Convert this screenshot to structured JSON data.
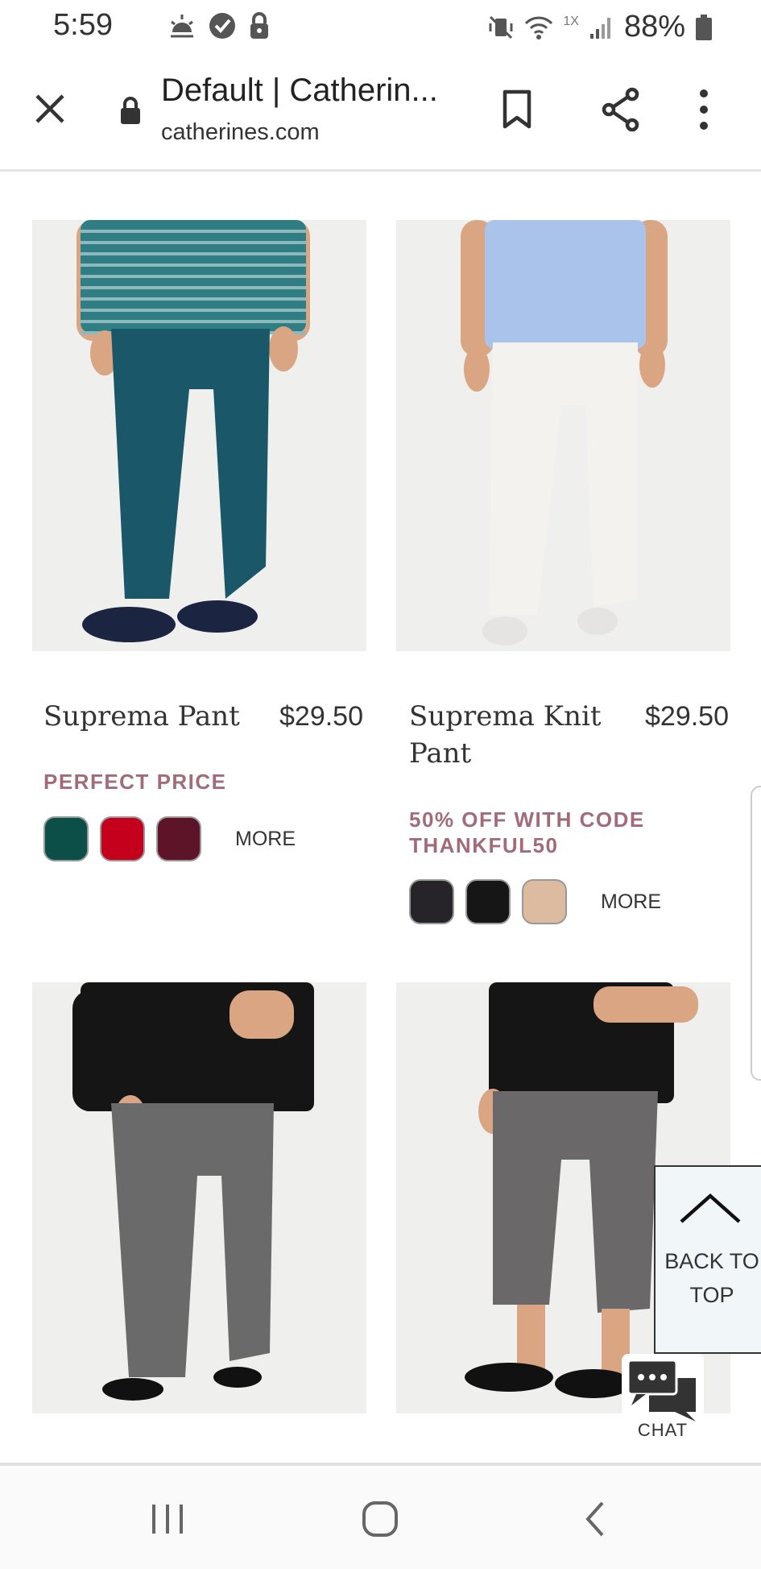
{
  "status_bar": {
    "time": "5:59",
    "network_label": "1X",
    "battery": "88%"
  },
  "browser": {
    "page_title": "Default | Catherin...",
    "domain": "catherines.com"
  },
  "products": [
    {
      "name": "Suprema Pant",
      "price": "$29.50",
      "promo": "PERFECT PRICE",
      "swatches": [
        "#0c4f48",
        "#c4001c",
        "#5e1428"
      ],
      "more_label": "MORE",
      "top_color": "#2f7e84",
      "bottom_color": "#1a5768",
      "shoe_color": "#1b2440"
    },
    {
      "name": "Suprema Knit Pant",
      "price": "$29.50",
      "promo": "50% OFF WITH CODE THANKFUL50",
      "swatches": [
        "#262428",
        "#161616",
        "#dcbba0"
      ],
      "more_label": "MORE",
      "top_color": "#a9c3ea",
      "bottom_color": "#f4f2ee",
      "shoe_color": "#e6e4e2"
    },
    {
      "top_color": "#151515",
      "bottom_color": "#6b6a6a",
      "shoe_color": "#111111"
    },
    {
      "top_color": "#151515",
      "bottom_color": "#6a6868",
      "shoe_color": "#111111"
    }
  ],
  "back_to_top": {
    "label_line1": "BACK TO",
    "label_line2": "TOP"
  },
  "chat": {
    "label": "CHAT"
  },
  "colors": {
    "promo": "#a26b79",
    "skin": "#d9a582"
  }
}
